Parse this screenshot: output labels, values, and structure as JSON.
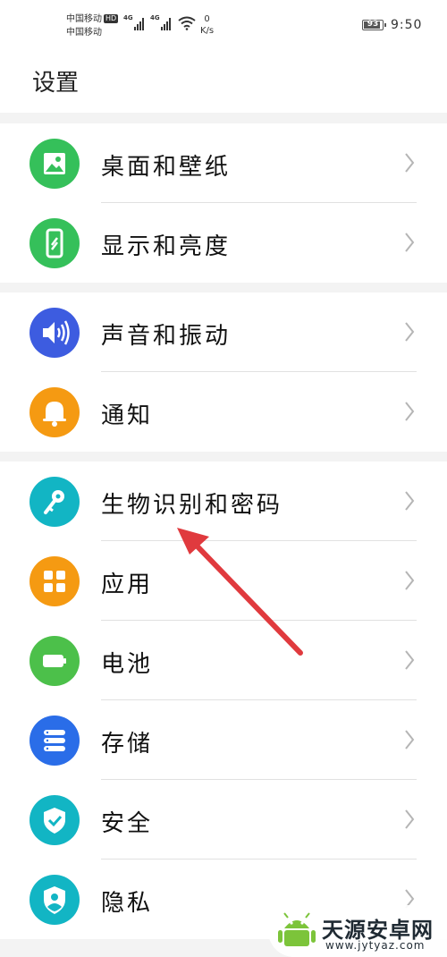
{
  "status_bar": {
    "carrier_1": "中国移动",
    "hd_badge": "HD",
    "carrier_2": "中国移动",
    "network_1": "4G",
    "network_2": "4G",
    "speed_value": "0",
    "speed_unit": "K/s",
    "battery_level": "93",
    "time": "9:50"
  },
  "header": {
    "title": "设置"
  },
  "groups": [
    {
      "items": [
        {
          "label": "桌面和壁纸",
          "icon": "wallpaper-icon",
          "color": "#35c05a"
        },
        {
          "label": "显示和亮度",
          "icon": "display-icon",
          "color": "#35c05a"
        }
      ]
    },
    {
      "items": [
        {
          "label": "声音和振动",
          "icon": "sound-icon",
          "color": "#3d5ce0"
        },
        {
          "label": "通知",
          "icon": "bell-icon",
          "color": "#f59a12"
        }
      ]
    },
    {
      "items": [
        {
          "label": "生物识别和密码",
          "icon": "key-icon",
          "color": "#12b5c4"
        },
        {
          "label": "应用",
          "icon": "apps-grid-icon",
          "color": "#f59a12"
        },
        {
          "label": "电池",
          "icon": "battery-icon",
          "color": "#4cc04a"
        },
        {
          "label": "存储",
          "icon": "storage-icon",
          "color": "#2a6de8"
        },
        {
          "label": "安全",
          "icon": "shield-icon",
          "color": "#12b5c4"
        },
        {
          "label": "隐私",
          "icon": "privacy-icon",
          "color": "#12b5c4"
        }
      ]
    }
  ],
  "annotation": {
    "color": "#e03a3e"
  },
  "watermark": {
    "name": "天源安卓网",
    "url": "www.jytyaz.com"
  }
}
